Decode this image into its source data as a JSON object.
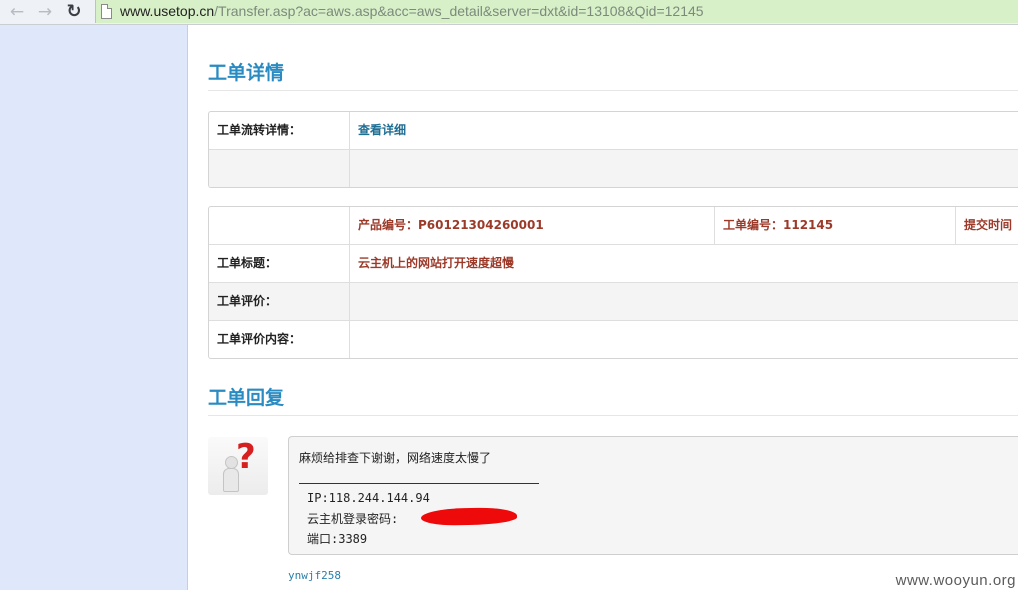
{
  "browser": {
    "url_host": "www.usetop.cn",
    "url_path": "/Transfer.asp?ac=aws.asp&acc=aws_detail&server=dxt&id=13108&Qid=12145"
  },
  "detail": {
    "title": "工单详情",
    "flow_label": "工单流转详情：",
    "flow_link": "查看详细"
  },
  "info": {
    "product_no": "产品编号：P60121304260001",
    "ticket_no": "工单编号：112145",
    "submit_time": "提交时间",
    "title_label": "工单标题：",
    "title_value": "云主机上的网站打开速度超慢",
    "rating_label": "工单评价：",
    "rating_content_label": "工单评价内容："
  },
  "reply": {
    "title": "工单回复",
    "message": "麻烦给排查下谢谢，网络速度太慢了",
    "ip_line": "IP:118.244.144.94",
    "password_label": "云主机登录密码:",
    "port_line": "端口:3389",
    "author": "ynwjf258"
  },
  "watermark": "www.wooyun.org",
  "colors": {
    "accent_blue": "#2a8bc2",
    "value_red": "#9c3a2a",
    "redaction": "#ee0a0a"
  }
}
